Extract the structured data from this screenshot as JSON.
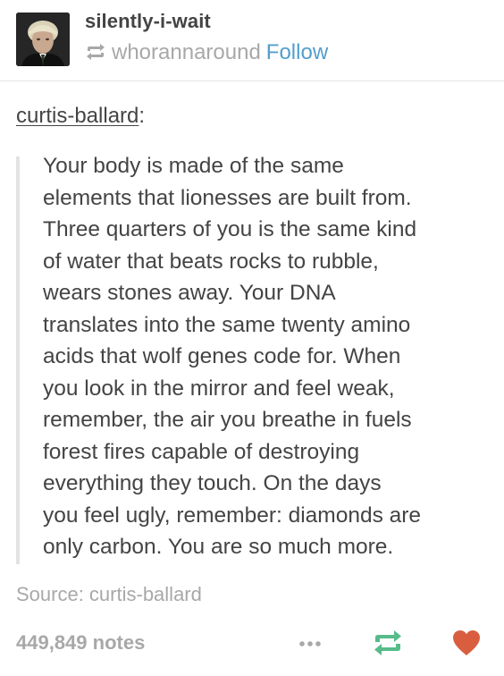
{
  "post": {
    "author": "silently-i-wait",
    "reblogged_from": "whorannaround",
    "follow_label": "Follow",
    "source_user": "curtis-ballard",
    "source_user_suffix": ":",
    "quote_lines": [
      "Your body is made of the same",
      "elements that lionesses are built from.",
      "Three quarters of you is the same kind",
      "of water that beats rocks to rubble,",
      "wears stones away. Your DNA",
      "translates into the same twenty amino",
      "acids that wolf genes code for. When",
      "you look in the mirror and feel weak,",
      "remember, the air you breathe in fuels",
      "forest fires capable of destroying",
      "everything they touch. On the days",
      "you feel ugly, remember: diamonds are",
      "only carbon. You are so much more."
    ],
    "source_label": "Source: curtis-ballard",
    "notes": "449,849 notes"
  },
  "icons": {
    "avatar": "avatar",
    "reblog_small": "reblog-icon",
    "more": "more-icon",
    "reblog": "reblog-icon",
    "like": "heart-icon"
  },
  "colors": {
    "text": "#444444",
    "muted": "#a8a8a8",
    "link": "#529ecc",
    "reblog_green": "#56bc8a",
    "like_red": "#d95e40"
  }
}
